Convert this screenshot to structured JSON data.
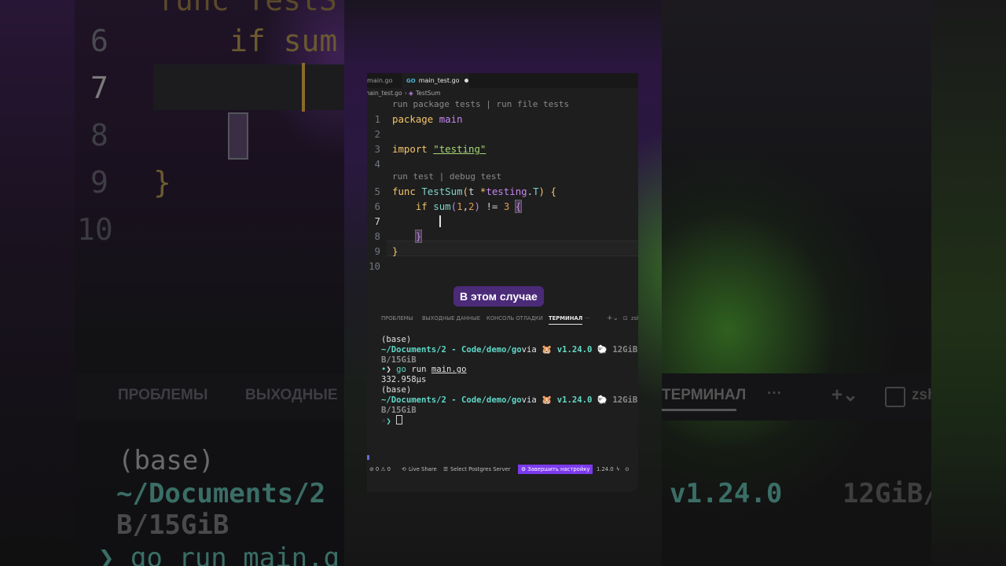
{
  "background_zoom": {
    "code_lines": [
      {
        "num": "6",
        "text": "if sum"
      },
      {
        "num": "7",
        "text": ""
      },
      {
        "num": "8",
        "text": "}"
      },
      {
        "num": "9",
        "text": "}"
      },
      {
        "num": "10",
        "text": ""
      }
    ],
    "top_fragment": "func TestS",
    "panel_tabs": [
      "ПРОБЛЕМЫ",
      "ВЫХОДНЫЕ",
      "ТЕРМИНАЛ",
      "zsh"
    ],
    "term_lines": [
      "(base)",
      "~/Documents/2 -",
      "B/15GiB",
      "❯ go run main.g"
    ],
    "right_term": {
      "version": "v1.24.0",
      "mem": "12GiB/"
    }
  },
  "editor": {
    "tabs": [
      {
        "label": "main.go",
        "active": false
      },
      {
        "label": "main_test.go",
        "active": true,
        "modified": true,
        "badge": "GO"
      }
    ],
    "breadcrumb": {
      "file": "main_test.go",
      "separator": "›",
      "symbol": "TestSum"
    },
    "codelens_top": "run package tests | run file tests",
    "codelens_func": "run test | debug test",
    "lines": [
      {
        "n": "1",
        "text": "package main"
      },
      {
        "n": "2",
        "text": ""
      },
      {
        "n": "3",
        "text": "import \"testing\""
      },
      {
        "n": "4",
        "text": ""
      },
      {
        "n": "5",
        "text": "func TestSum(t *testing.T) {"
      },
      {
        "n": "6",
        "text": "    if sum(1,2) != 3 {"
      },
      {
        "n": "7",
        "text": ""
      },
      {
        "n": "8",
        "text": "    }"
      },
      {
        "n": "9",
        "text": "}"
      },
      {
        "n": "10",
        "text": ""
      }
    ],
    "current_line": "7"
  },
  "subtitle": "В этом случае",
  "panel": {
    "tabs": [
      "ПРОБЛЕМЫ",
      "ВЫХОДНЫЕ ДАННЫЕ",
      "КОНСОЛЬ ОТЛАДКИ",
      "ТЕРМИНАЛ"
    ],
    "active_tab": "ТЕРМИНАЛ",
    "more": "···",
    "add": "+⌄",
    "shell": "zsh"
  },
  "terminal": {
    "line1": "(base)",
    "path": "~/Documents/2 - Code/demo/go",
    "via": "via",
    "ver": "v1.24.0",
    "mem": "12GiB/",
    "mem2": "B/15GiB",
    "prompt": "❯",
    "cmd_go": "go",
    "cmd_run": "run",
    "cmd_file": "main.go",
    "output": "332.958µs",
    "line_base2": "(base)"
  },
  "statusbar": {
    "problems": "⊘ 0 ⚠ 0",
    "liveshare": "Live Share",
    "postgres": "Select Postgres Server",
    "finish": "Завершить настройку",
    "goversion": "1.24.0"
  },
  "colors": {
    "accent": "#7c3aed",
    "subtitle_bg": "#4b2a78",
    "keyword": "#f2c46d",
    "path": "#5fd7c7"
  }
}
